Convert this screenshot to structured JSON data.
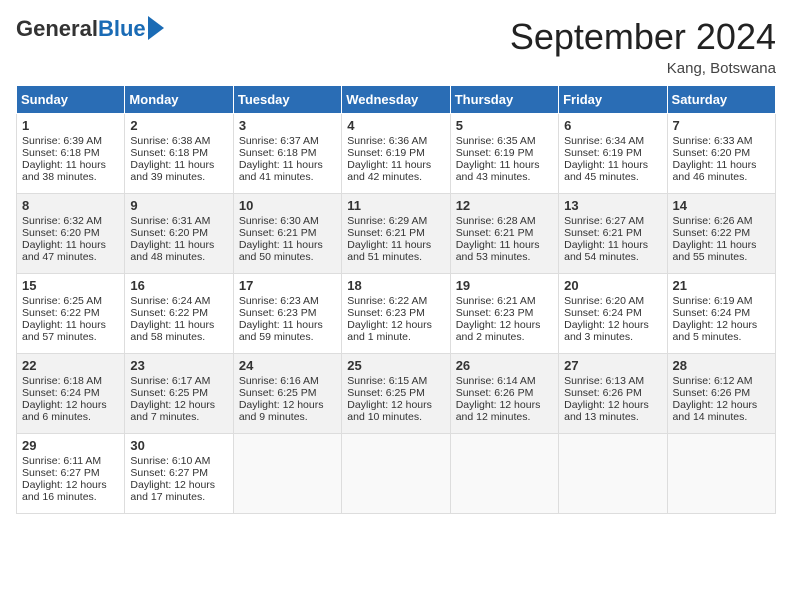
{
  "header": {
    "logo_general": "General",
    "logo_blue": "Blue",
    "month_year": "September 2024",
    "location": "Kang, Botswana"
  },
  "weekdays": [
    "Sunday",
    "Monday",
    "Tuesday",
    "Wednesday",
    "Thursday",
    "Friday",
    "Saturday"
  ],
  "weeks": [
    [
      {
        "day": "1",
        "lines": [
          "Sunrise: 6:39 AM",
          "Sunset: 6:18 PM",
          "Daylight: 11 hours",
          "and 38 minutes."
        ]
      },
      {
        "day": "2",
        "lines": [
          "Sunrise: 6:38 AM",
          "Sunset: 6:18 PM",
          "Daylight: 11 hours",
          "and 39 minutes."
        ]
      },
      {
        "day": "3",
        "lines": [
          "Sunrise: 6:37 AM",
          "Sunset: 6:18 PM",
          "Daylight: 11 hours",
          "and 41 minutes."
        ]
      },
      {
        "day": "4",
        "lines": [
          "Sunrise: 6:36 AM",
          "Sunset: 6:19 PM",
          "Daylight: 11 hours",
          "and 42 minutes."
        ]
      },
      {
        "day": "5",
        "lines": [
          "Sunrise: 6:35 AM",
          "Sunset: 6:19 PM",
          "Daylight: 11 hours",
          "and 43 minutes."
        ]
      },
      {
        "day": "6",
        "lines": [
          "Sunrise: 6:34 AM",
          "Sunset: 6:19 PM",
          "Daylight: 11 hours",
          "and 45 minutes."
        ]
      },
      {
        "day": "7",
        "lines": [
          "Sunrise: 6:33 AM",
          "Sunset: 6:20 PM",
          "Daylight: 11 hours",
          "and 46 minutes."
        ]
      }
    ],
    [
      {
        "day": "8",
        "lines": [
          "Sunrise: 6:32 AM",
          "Sunset: 6:20 PM",
          "Daylight: 11 hours",
          "and 47 minutes."
        ]
      },
      {
        "day": "9",
        "lines": [
          "Sunrise: 6:31 AM",
          "Sunset: 6:20 PM",
          "Daylight: 11 hours",
          "and 48 minutes."
        ]
      },
      {
        "day": "10",
        "lines": [
          "Sunrise: 6:30 AM",
          "Sunset: 6:21 PM",
          "Daylight: 11 hours",
          "and 50 minutes."
        ]
      },
      {
        "day": "11",
        "lines": [
          "Sunrise: 6:29 AM",
          "Sunset: 6:21 PM",
          "Daylight: 11 hours",
          "and 51 minutes."
        ]
      },
      {
        "day": "12",
        "lines": [
          "Sunrise: 6:28 AM",
          "Sunset: 6:21 PM",
          "Daylight: 11 hours",
          "and 53 minutes."
        ]
      },
      {
        "day": "13",
        "lines": [
          "Sunrise: 6:27 AM",
          "Sunset: 6:21 PM",
          "Daylight: 11 hours",
          "and 54 minutes."
        ]
      },
      {
        "day": "14",
        "lines": [
          "Sunrise: 6:26 AM",
          "Sunset: 6:22 PM",
          "Daylight: 11 hours",
          "and 55 minutes."
        ]
      }
    ],
    [
      {
        "day": "15",
        "lines": [
          "Sunrise: 6:25 AM",
          "Sunset: 6:22 PM",
          "Daylight: 11 hours",
          "and 57 minutes."
        ]
      },
      {
        "day": "16",
        "lines": [
          "Sunrise: 6:24 AM",
          "Sunset: 6:22 PM",
          "Daylight: 11 hours",
          "and 58 minutes."
        ]
      },
      {
        "day": "17",
        "lines": [
          "Sunrise: 6:23 AM",
          "Sunset: 6:23 PM",
          "Daylight: 11 hours",
          "and 59 minutes."
        ]
      },
      {
        "day": "18",
        "lines": [
          "Sunrise: 6:22 AM",
          "Sunset: 6:23 PM",
          "Daylight: 12 hours",
          "and 1 minute."
        ]
      },
      {
        "day": "19",
        "lines": [
          "Sunrise: 6:21 AM",
          "Sunset: 6:23 PM",
          "Daylight: 12 hours",
          "and 2 minutes."
        ]
      },
      {
        "day": "20",
        "lines": [
          "Sunrise: 6:20 AM",
          "Sunset: 6:24 PM",
          "Daylight: 12 hours",
          "and 3 minutes."
        ]
      },
      {
        "day": "21",
        "lines": [
          "Sunrise: 6:19 AM",
          "Sunset: 6:24 PM",
          "Daylight: 12 hours",
          "and 5 minutes."
        ]
      }
    ],
    [
      {
        "day": "22",
        "lines": [
          "Sunrise: 6:18 AM",
          "Sunset: 6:24 PM",
          "Daylight: 12 hours",
          "and 6 minutes."
        ]
      },
      {
        "day": "23",
        "lines": [
          "Sunrise: 6:17 AM",
          "Sunset: 6:25 PM",
          "Daylight: 12 hours",
          "and 7 minutes."
        ]
      },
      {
        "day": "24",
        "lines": [
          "Sunrise: 6:16 AM",
          "Sunset: 6:25 PM",
          "Daylight: 12 hours",
          "and 9 minutes."
        ]
      },
      {
        "day": "25",
        "lines": [
          "Sunrise: 6:15 AM",
          "Sunset: 6:25 PM",
          "Daylight: 12 hours",
          "and 10 minutes."
        ]
      },
      {
        "day": "26",
        "lines": [
          "Sunrise: 6:14 AM",
          "Sunset: 6:26 PM",
          "Daylight: 12 hours",
          "and 12 minutes."
        ]
      },
      {
        "day": "27",
        "lines": [
          "Sunrise: 6:13 AM",
          "Sunset: 6:26 PM",
          "Daylight: 12 hours",
          "and 13 minutes."
        ]
      },
      {
        "day": "28",
        "lines": [
          "Sunrise: 6:12 AM",
          "Sunset: 6:26 PM",
          "Daylight: 12 hours",
          "and 14 minutes."
        ]
      }
    ],
    [
      {
        "day": "29",
        "lines": [
          "Sunrise: 6:11 AM",
          "Sunset: 6:27 PM",
          "Daylight: 12 hours",
          "and 16 minutes."
        ]
      },
      {
        "day": "30",
        "lines": [
          "Sunrise: 6:10 AM",
          "Sunset: 6:27 PM",
          "Daylight: 12 hours",
          "and 17 minutes."
        ]
      },
      {
        "day": "",
        "lines": []
      },
      {
        "day": "",
        "lines": []
      },
      {
        "day": "",
        "lines": []
      },
      {
        "day": "",
        "lines": []
      },
      {
        "day": "",
        "lines": []
      }
    ]
  ]
}
